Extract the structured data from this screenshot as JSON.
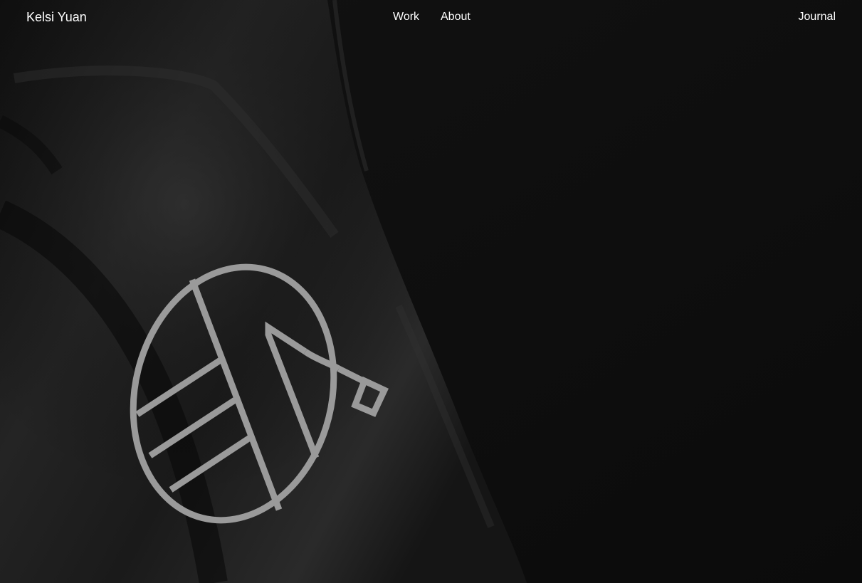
{
  "site": {
    "brand": "Kelsi Yuan"
  },
  "nav": {
    "work": "Work",
    "about": "About",
    "journal": "Journal"
  },
  "colors": {
    "background": "#0e0e0e",
    "fabric": "#1c1c1c",
    "logo_stroke": "#9a9a9a",
    "text": "#ffffff"
  },
  "hero": {
    "image": "black-fabric-flag-with-line-logo",
    "logo_icon": "circular-geometric-monogram-icon"
  }
}
